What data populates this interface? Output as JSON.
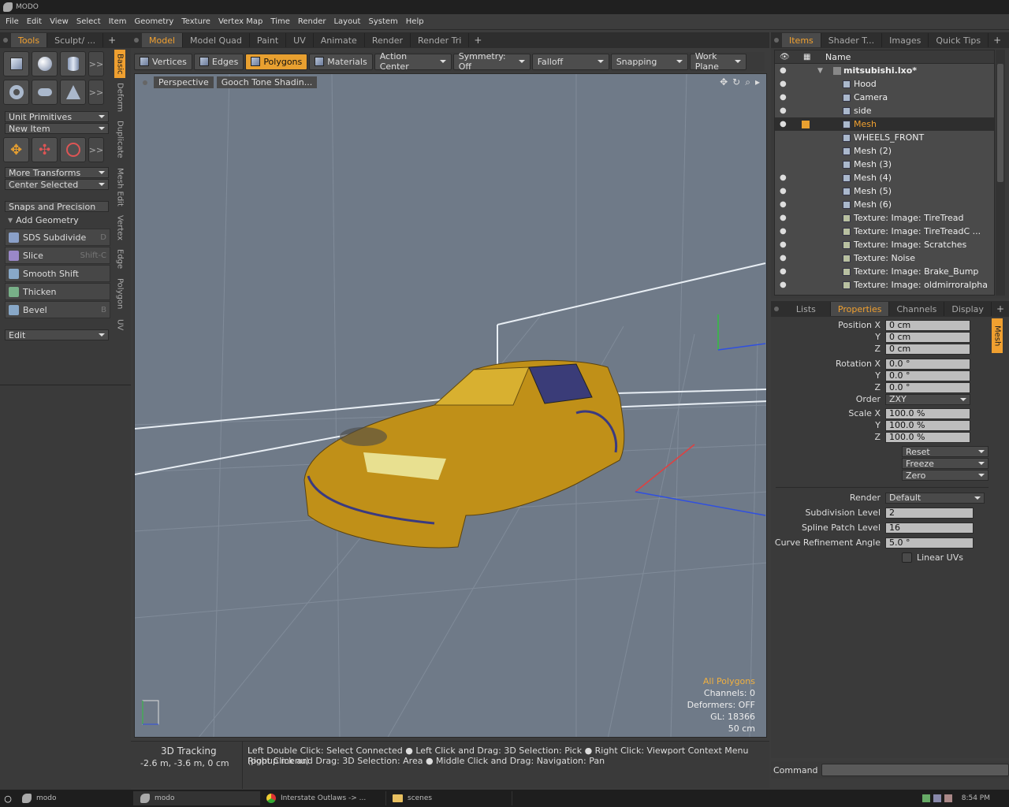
{
  "app": {
    "title": "MODO"
  },
  "menu": [
    "File",
    "Edit",
    "View",
    "Select",
    "Item",
    "Geometry",
    "Texture",
    "Vertex Map",
    "Time",
    "Render",
    "Layout",
    "System",
    "Help"
  ],
  "left_tabs": [
    "Tools",
    "Sculpt/ ..."
  ],
  "center_tabs": [
    "Model",
    "Model Quad",
    "Paint",
    "UV",
    "Animate",
    "Render",
    "Render Tri"
  ],
  "right_tabs": [
    "Items",
    "Shader T...",
    "Images",
    "Quick Tips"
  ],
  "tools": {
    "unit_primitives": "Unit Primitives",
    "new_item": "New Item",
    "more_transforms": "More Transforms",
    "center_selected": "Center Selected",
    "snaps": "Snaps and Precision",
    "add_geometry": "Add Geometry",
    "list": [
      {
        "label": "SDS Subdivide",
        "shortcut": "D",
        "color": "#8aa0c8"
      },
      {
        "label": "Slice",
        "shortcut": "Shift-C",
        "color": "#9a88c8"
      },
      {
        "label": "Smooth Shift",
        "shortcut": "",
        "color": "#88a8c8"
      },
      {
        "label": "Thicken",
        "shortcut": "",
        "color": "#78b088"
      },
      {
        "label": "Bevel",
        "shortcut": "B",
        "color": "#88a8c8"
      }
    ],
    "edit": "Edit",
    "more": ">>"
  },
  "vtabs": [
    "Basic",
    "Deform",
    "Duplicate",
    "Mesh Edit",
    "Vertex",
    "Edge",
    "Polygon",
    "UV"
  ],
  "vpbar": {
    "vertices": "Vertices",
    "edges": "Edges",
    "polygons": "Polygons",
    "materials": "Materials",
    "action_center": "Action Center",
    "symmetry": "Symmetry: Off",
    "falloff": "Falloff",
    "snapping": "Snapping",
    "work_plane": "Work Plane"
  },
  "viewport": {
    "view": "Perspective",
    "shading": "Gooch Tone Shadin...",
    "info": {
      "selection": "All Polygons",
      "channels": "Channels: 0",
      "deformers": "Deformers: OFF",
      "gl": "GL: 18366",
      "scale": "50 cm"
    }
  },
  "statusbar": {
    "mode": "3D Tracking",
    "coords": "-2.6 m, -3.6 m, 0 cm",
    "hint1": "Left Double Click: Select Connected ● Left Click and Drag: 3D Selection: Pick ● Right Click: Viewport Context Menu (popup menu)",
    "hint2": "Right Click and Drag: 3D Selection: Area ● Middle Click and Drag: Navigation: Pan"
  },
  "items": {
    "header": "Name",
    "scene": "mitsubishi.lxo*",
    "rows": [
      {
        "name": "Hood",
        "eye": true,
        "tex": false,
        "sel": false
      },
      {
        "name": "Camera",
        "eye": true,
        "tex": false,
        "sel": false
      },
      {
        "name": "side",
        "eye": true,
        "tex": false,
        "sel": false
      },
      {
        "name": "Mesh",
        "eye": true,
        "tex": false,
        "sel": true
      },
      {
        "name": "WHEELS_FRONT",
        "eye": false,
        "tex": false,
        "sel": false
      },
      {
        "name": "Mesh (2)",
        "eye": false,
        "tex": false,
        "sel": false
      },
      {
        "name": "Mesh (3)",
        "eye": false,
        "tex": false,
        "sel": false
      },
      {
        "name": "Mesh (4)",
        "eye": true,
        "tex": false,
        "sel": false
      },
      {
        "name": "Mesh (5)",
        "eye": true,
        "tex": false,
        "sel": false
      },
      {
        "name": "Mesh (6)",
        "eye": true,
        "tex": false,
        "sel": false
      },
      {
        "name": "Texture: Image: TireTread",
        "eye": true,
        "tex": true,
        "sel": false
      },
      {
        "name": "Texture: Image: TireTreadC ...",
        "eye": true,
        "tex": true,
        "sel": false
      },
      {
        "name": "Texture: Image: Scratches",
        "eye": true,
        "tex": true,
        "sel": false
      },
      {
        "name": "Texture: Noise",
        "eye": true,
        "tex": true,
        "sel": false
      },
      {
        "name": "Texture: Image: Brake_Bump",
        "eye": true,
        "tex": true,
        "sel": false
      },
      {
        "name": "Texture: Image: oldmirroralpha",
        "eye": true,
        "tex": true,
        "sel": false
      }
    ]
  },
  "prop_tabs": [
    "Lists",
    "Properties",
    "Channels",
    "Display"
  ],
  "prop_side_tab": "Mesh",
  "props": {
    "position": [
      {
        "label": "Position X",
        "value": "0 cm"
      },
      {
        "label": "Y",
        "value": "0 cm"
      },
      {
        "label": "Z",
        "value": "0 cm"
      }
    ],
    "rotation": [
      {
        "label": "Rotation X",
        "value": "0.0 °"
      },
      {
        "label": "Y",
        "value": "0.0 °"
      },
      {
        "label": "Z",
        "value": "0.0 °"
      }
    ],
    "order_label": "Order",
    "order": "ZXY",
    "scale": [
      {
        "label": "Scale X",
        "value": "100.0 %"
      },
      {
        "label": "Y",
        "value": "100.0 %"
      },
      {
        "label": "Z",
        "value": "100.0 %"
      }
    ],
    "reset": "Reset",
    "freeze": "Freeze",
    "zero": "Zero",
    "render_label": "Render",
    "render": "Default",
    "subdiv_label": "Subdivision Level",
    "subdiv": "2",
    "spline_label": "Spline Patch Level",
    "spline": "16",
    "curve_label": "Curve Refinement Angle",
    "curve": "5.0 °",
    "linear_uvs": "Linear UVs"
  },
  "command_label": "Command",
  "taskbar": {
    "items": [
      "modo",
      "modo",
      "Interstate Outlaws -> ...",
      "scenes"
    ],
    "clock": "8:54 PM"
  }
}
